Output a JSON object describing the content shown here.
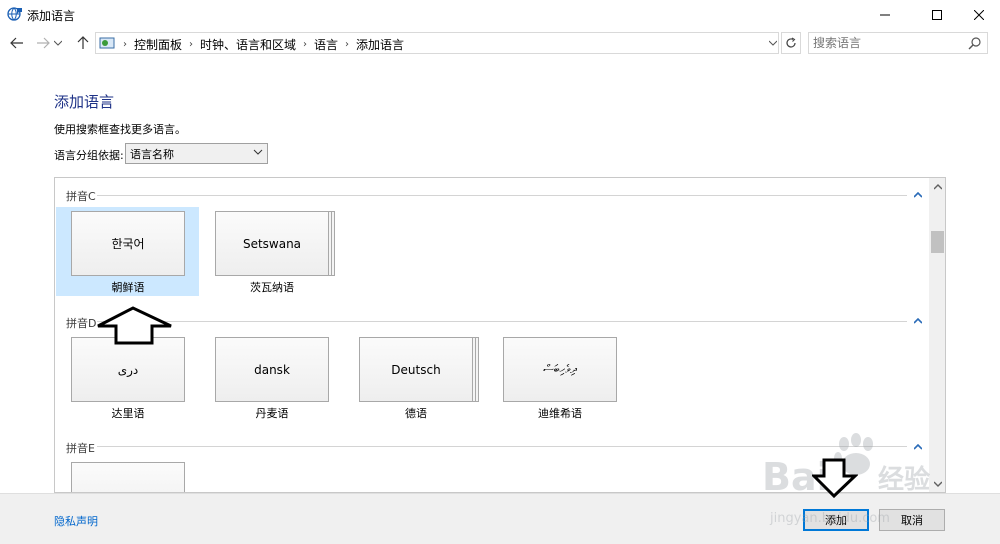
{
  "window": {
    "title": "添加语言",
    "minimize_glyph": "—",
    "maximize_glyph": "☐",
    "close_glyph": "✕"
  },
  "nav": {
    "back_glyph": "←",
    "forward_glyph": "→",
    "recent_glyph": "⌄",
    "up_glyph": "↑",
    "breadcrumb": [
      "控制面板",
      "时钟、语言和区域",
      "语言",
      "添加语言"
    ],
    "breadcrumb_separator": "›",
    "refresh_glyph": "↻",
    "search_placeholder": "搜索语言"
  },
  "main": {
    "title": "添加语言",
    "hint": "使用搜索框查找更多语言。",
    "group_by_label": "语言分组依据:",
    "group_by_value": "语言名称",
    "sections": [
      {
        "header": "拼音C",
        "tiles": [
          {
            "tile_text": "한국어",
            "name": "朝鲜语",
            "stacked": false,
            "selected": true
          },
          {
            "tile_text": "Setswana",
            "name": "茨瓦纳语",
            "stacked": true,
            "selected": false
          }
        ]
      },
      {
        "header": "拼音D",
        "tiles": [
          {
            "tile_text": "دری",
            "name": "达里语",
            "stacked": false,
            "selected": false
          },
          {
            "tile_text": "dansk",
            "name": "丹麦语",
            "stacked": false,
            "selected": false
          },
          {
            "tile_text": "Deutsch",
            "name": "德语",
            "stacked": true,
            "selected": false
          },
          {
            "tile_text": "ދިވެހިބަސް",
            "name": "迪维希语",
            "stacked": false,
            "selected": false
          }
        ]
      },
      {
        "header": "拼音E",
        "tiles": [
          {
            "tile_text": "",
            "name": "",
            "stacked": false,
            "selected": false
          }
        ]
      }
    ]
  },
  "footer": {
    "privacy_link": "隐私声明",
    "add_button": "添加",
    "cancel_button": "取消"
  },
  "watermark": {
    "brand": "Bai",
    "brand2": "经验",
    "url": "jingyan.baidu.com"
  },
  "colors": {
    "accent": "#0078d7",
    "title_blue": "#1e3287",
    "selection": "#cce8ff"
  }
}
